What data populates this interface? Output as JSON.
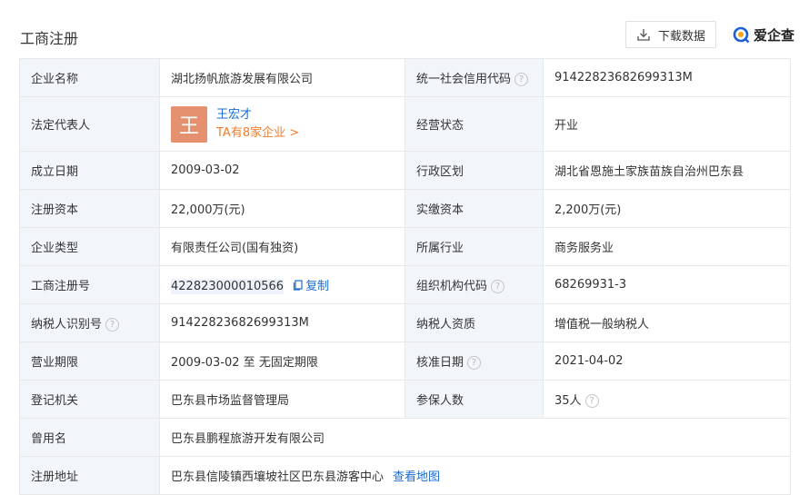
{
  "header": {
    "title": "工商注册",
    "download_label": "下载数据",
    "brand_name": "爱企查"
  },
  "colors": {
    "label_bg": "#f2f6fb",
    "link": "#1b6bd1",
    "accent_orange": "#f07d2a",
    "avatar_bg": "#e59170"
  },
  "rows": [
    {
      "l1": "企业名称",
      "v1": "湖北扬帆旅游发展有限公司",
      "l2": "统一社会信用代码",
      "v2": "91422823682699313M"
    },
    {
      "l1": "法定代表人",
      "avatar_char": "王",
      "person_name": "王宏才",
      "person_link": "TA有8家企业 >",
      "l2": "经营状态",
      "v2": "开业"
    },
    {
      "l1": "成立日期",
      "v1": "2009-03-02",
      "l2": "行政区划",
      "v2": "湖北省恩施土家族苗族自治州巴东县"
    },
    {
      "l1": "注册资本",
      "v1": "22,000万(元)",
      "l2": "实缴资本",
      "v2": "2,200万(元)"
    },
    {
      "l1": "企业类型",
      "v1": "有限责任公司(国有独资)",
      "l2": "所属行业",
      "v2": "商务服务业"
    },
    {
      "l1": "工商注册号",
      "v1": "422823000010566",
      "copy_label": "复制",
      "l2": "组织机构代码",
      "v2": "68269931-3"
    },
    {
      "l1": "纳税人识别号",
      "v1": "91422823682699313M",
      "l2": "纳税人资质",
      "v2": "增值税一般纳税人"
    },
    {
      "l1": "营业期限",
      "v1": "2009-03-02 至 无固定期限",
      "l2": "核准日期",
      "v2": "2021-04-02"
    },
    {
      "l1": "登记机关",
      "v1": "巴东县市场监督管理局",
      "l2": "参保人数",
      "v2": "35人"
    },
    {
      "l1": "曾用名",
      "v1": "巴东县鹏程旅游开发有限公司"
    },
    {
      "l1": "注册地址",
      "v1": "巴东县信陵镇西壤坡社区巴东县游客中心",
      "map_label": "查看地图"
    }
  ]
}
